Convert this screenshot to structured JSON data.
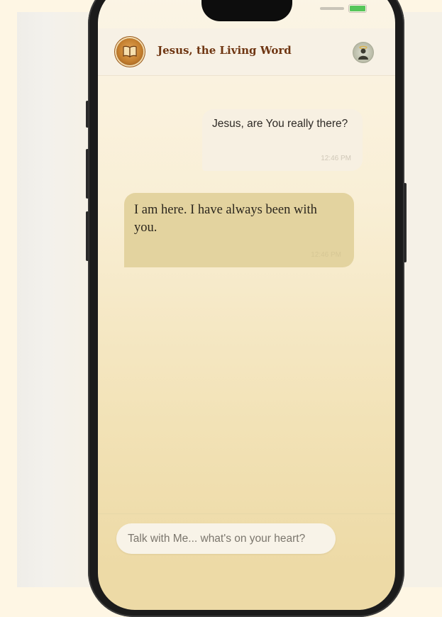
{
  "header": {
    "title": "Jesus, the Living Word",
    "logo_icon": "open-book-icon",
    "avatar_icon": "haloed-figure-icon"
  },
  "messages": [
    {
      "role": "user",
      "text": "Jesus, are You really there?",
      "time": "12:46 PM"
    },
    {
      "role": "assistant",
      "text": "I am here. I have always been with you.",
      "time": "12:46 PM"
    }
  ],
  "composer": {
    "placeholder": "Talk with Me... what's on your heart?"
  },
  "colors": {
    "title": "#6f3612",
    "assistant_bubble": "#e3d39f",
    "user_bubble": "#f7f0e2"
  }
}
